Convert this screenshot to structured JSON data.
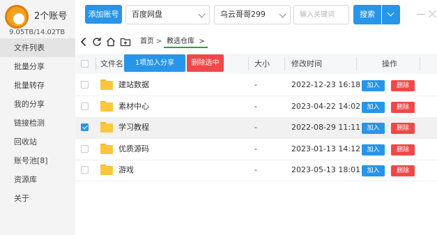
{
  "app": {
    "account_count": "2个账号",
    "storage": "9.05TB/14.02TB",
    "accent_color": "#2795e9",
    "danger_color": "#f04848"
  },
  "sidebar": {
    "items": [
      {
        "label": "文件列表",
        "active": true
      },
      {
        "label": "批量分享",
        "active": false
      },
      {
        "label": "批量转存",
        "active": false
      },
      {
        "label": "我的分享",
        "active": false
      },
      {
        "label": "链接检测",
        "active": false
      },
      {
        "label": "回收站",
        "active": false
      },
      {
        "label": "账号池[8]",
        "active": false
      },
      {
        "label": "资源库",
        "active": false
      },
      {
        "label": "关于",
        "active": false
      }
    ]
  },
  "toolbar": {
    "add_account_label": "添加账号",
    "disk_select": "百度网盘",
    "user_select": "乌云哥哥299",
    "keyword_placeholder": "输入关键词",
    "search_label": "搜索"
  },
  "nav": {
    "icons": [
      "back-icon",
      "refresh-icon",
      "home-icon",
      "new-folder-icon"
    ],
    "breadcrumb": [
      "首页",
      "教选仓库"
    ]
  },
  "table": {
    "headers": {
      "name": "文件名",
      "size": "大小",
      "mtime": "修改时间",
      "actions": "操作"
    },
    "share_selected_label": "1项加入分享",
    "delete_selected_label": "删除选中",
    "add_label": "加入",
    "delete_label": "删除",
    "rows": [
      {
        "name": "建站数据",
        "size": "-",
        "mtime": "2022-12-23 16:18",
        "checked": false
      },
      {
        "name": "素材中心",
        "size": "-",
        "mtime": "2023-04-22 14:02",
        "checked": false
      },
      {
        "name": "学习教程",
        "size": "-",
        "mtime": "2022-08-29 11:11",
        "checked": true
      },
      {
        "name": "优质源码",
        "size": "-",
        "mtime": "2023-01-13 14:12",
        "checked": false
      },
      {
        "name": "游戏",
        "size": "-",
        "mtime": "2023-05-13 18:01",
        "checked": false
      }
    ]
  }
}
